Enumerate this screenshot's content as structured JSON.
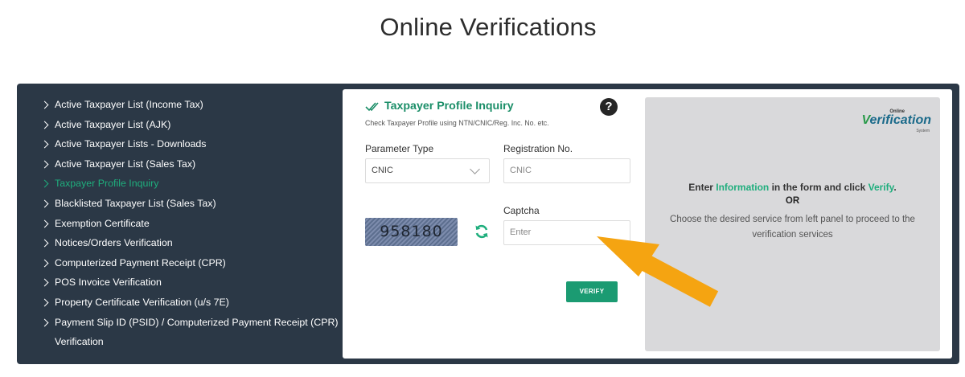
{
  "page": {
    "title": "Online Verifications"
  },
  "sidebar": {
    "items": [
      {
        "label": "Active Taxpayer List (Income Tax)"
      },
      {
        "label": "Active Taxpayer List (AJK)"
      },
      {
        "label": "Active Taxpayer Lists - Downloads"
      },
      {
        "label": "Active Taxpayer List (Sales Tax)"
      },
      {
        "label": "Taxpayer Profile Inquiry",
        "active": true
      },
      {
        "label": "Blacklisted Taxpayer List (Sales Tax)"
      },
      {
        "label": "Exemption Certificate"
      },
      {
        "label": "Notices/Orders Verification"
      },
      {
        "label": "Computerized Payment Receipt (CPR)"
      },
      {
        "label": "POS Invoice Verification"
      },
      {
        "label": "Property Certificate Verification (u/s 7E)"
      },
      {
        "label": "Payment Slip ID (PSID) / Computerized Payment Receipt (CPR)",
        "label2": "Verification"
      }
    ],
    "active_color": "#1fae7d"
  },
  "form": {
    "title": "Taxpayer Profile Inquiry",
    "subtitle": "Check Taxpayer Profile using NTN/CNIC/Reg. Inc. No. etc.",
    "help_icon": "question-circle-icon",
    "parameter_type": {
      "label": "Parameter Type",
      "selected": "CNIC"
    },
    "registration": {
      "label": "Registration No.",
      "placeholder": "CNIC"
    },
    "captcha": {
      "label": "Captcha",
      "image_text": "958180",
      "placeholder": "Enter"
    },
    "verify_label": "VERIFY",
    "accent": "#1b9b72"
  },
  "info": {
    "logo": {
      "top": "Online",
      "main_v": "V",
      "main_rest": "erification",
      "bottom": "System"
    },
    "line1_pre": "Enter ",
    "line1_info": "Information",
    "line1_mid": " in the form and click ",
    "line1_verify": "Verify",
    "line1_end": ".",
    "or": "OR",
    "line3a": "Choose the desired service from left panel to proceed to the",
    "line3b": "verification services"
  },
  "annotation": {
    "arrow_color": "#f5a411"
  }
}
